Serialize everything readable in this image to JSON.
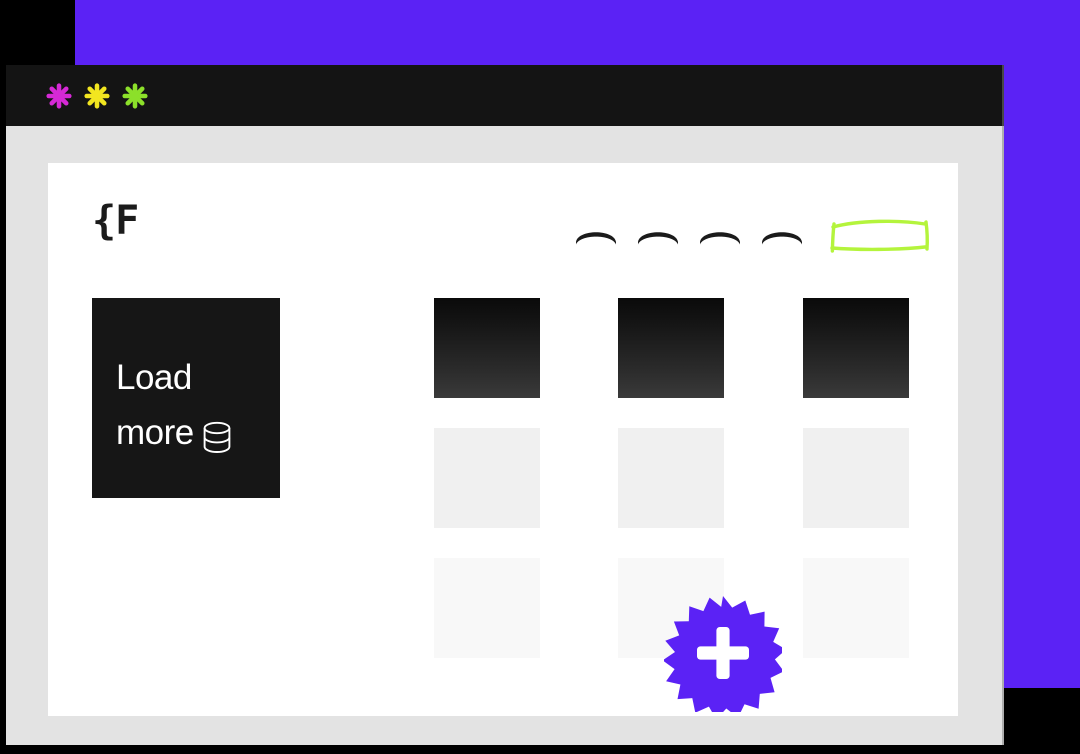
{
  "theme": {
    "accent_purple": "#5B22F5",
    "highlight_green": "#B4F43C",
    "window_chrome": "#141414",
    "window_frame": "#e3e3e3",
    "panel_bg": "#ffffff",
    "card_dark_top": "#0a0a0a",
    "card_dark_bottom": "#3a3a3a",
    "card_light": "#f0f0f0",
    "card_faint": "#f8f8f8"
  },
  "window": {
    "titlebar": {
      "dots": [
        {
          "name": "asterisk-magenta",
          "color": "#D629D6",
          "glyph": "*"
        },
        {
          "name": "asterisk-yellow",
          "color": "#F2E620",
          "glyph": "*"
        },
        {
          "name": "asterisk-green",
          "color": "#8CE02A",
          "glyph": "*"
        }
      ]
    }
  },
  "header": {
    "brand": "{F",
    "nav": {
      "items": [
        {
          "label": ""
        },
        {
          "label": ""
        },
        {
          "label": ""
        },
        {
          "label": ""
        }
      ],
      "highlight": {
        "label": "",
        "style": "hand-drawn-green-box",
        "color": "#B4F43C"
      }
    }
  },
  "main": {
    "load_more": {
      "line1": "Load",
      "line2": "more",
      "icon": "database-icon"
    },
    "cards": {
      "rows": [
        {
          "state": "loaded",
          "items": [
            {
              "label": ""
            },
            {
              "label": ""
            },
            {
              "label": ""
            }
          ]
        },
        {
          "state": "placeholder",
          "items": [
            {
              "label": ""
            },
            {
              "label": ""
            },
            {
              "label": ""
            }
          ]
        },
        {
          "state": "placeholder-faded",
          "items": [
            {
              "label": ""
            },
            {
              "label": ""
            },
            {
              "label": ""
            }
          ]
        }
      ]
    },
    "add_badge": {
      "icon": "plus-icon",
      "shape": "starburst",
      "points": 16,
      "color": "#5B22F5",
      "glyph": "+"
    }
  }
}
